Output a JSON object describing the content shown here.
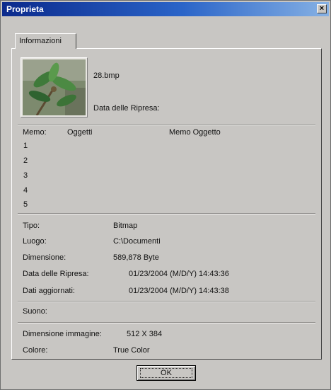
{
  "window": {
    "title": "Proprieta",
    "close_glyph": "×"
  },
  "tab": {
    "label": "Informazioni"
  },
  "file": {
    "name": "28.bmp",
    "capture_date_label": "Data delle Ripresa:"
  },
  "memo": {
    "col_memo": "Memo:",
    "col_oggetti": "Oggetti",
    "col_memo_oggetto": "Memo Oggetto",
    "rows": [
      "1",
      "2",
      "3",
      "4",
      "5"
    ]
  },
  "details": [
    {
      "label": "Tipo:",
      "value": "Bitmap"
    },
    {
      "label": "Luogo:",
      "value": "C:\\Documenti"
    },
    {
      "label": "Dimensione:",
      "value": "589,878 Byte"
    },
    {
      "label": "Data delle Ripresa:",
      "value": "01/23/2004 (M/D/Y)  14:43:36"
    },
    {
      "label": "Dati aggiornati:",
      "value": "01/23/2004 (M/D/Y)  14:43:38"
    }
  ],
  "sound": {
    "label": "Suono:"
  },
  "image_info": [
    {
      "label": "Dimensione immagine:",
      "value": "512 X 384"
    },
    {
      "label": "Colore:",
      "value": "True Color"
    }
  ],
  "buttons": {
    "ok": "OK"
  },
  "icons": {
    "close": "close-icon",
    "thumbnail": "plant-photo-thumbnail"
  },
  "colors": {
    "dialog_bg": "#c8c6c3",
    "title_start": "#0b2a8c",
    "title_end": "#86b1e4"
  }
}
